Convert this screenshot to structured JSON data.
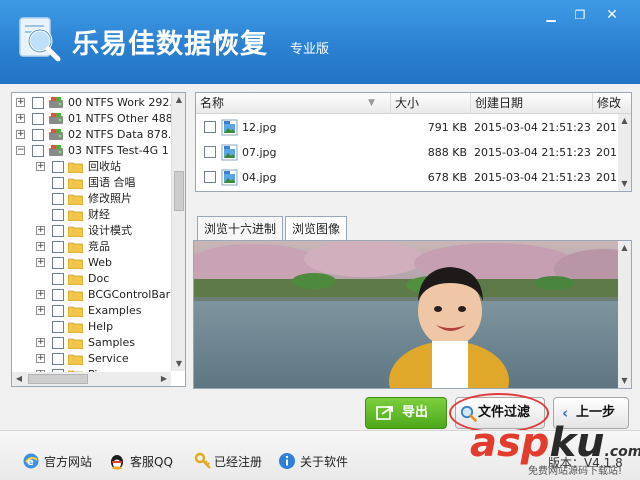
{
  "app": {
    "title": "乐易佳数据恢复",
    "edition": "专业版",
    "window_buttons": {
      "minimize": "▁",
      "maximize": "❐",
      "close": "✕"
    }
  },
  "tree": {
    "drives": [
      {
        "expander": "+",
        "label": "00  NTFS  Work  292."
      },
      {
        "expander": "+",
        "label": "01  NTFS  Other  488"
      },
      {
        "expander": "+",
        "label": "02  NTFS  Data  878."
      },
      {
        "expander": "−",
        "label": "03  NTFS  Test-4G  1"
      }
    ],
    "folders": [
      {
        "expander": "+",
        "label": "回收站"
      },
      {
        "expander": "",
        "label": "国语 合唱"
      },
      {
        "expander": "",
        "label": "修改照片"
      },
      {
        "expander": "",
        "label": "财经"
      },
      {
        "expander": "+",
        "label": "设计模式"
      },
      {
        "expander": "+",
        "label": "竞品"
      },
      {
        "expander": "+",
        "label": "Web"
      },
      {
        "expander": "",
        "label": "Doc"
      },
      {
        "expander": "+",
        "label": "BCGControlBarPr"
      },
      {
        "expander": "+",
        "label": "Examples"
      },
      {
        "expander": "",
        "label": "Help"
      },
      {
        "expander": "+",
        "label": "Samples"
      },
      {
        "expander": "+",
        "label": "Service"
      },
      {
        "expander": "+",
        "label": "Pic"
      }
    ]
  },
  "filelist": {
    "columns": [
      "名称",
      "大小",
      "创建日期",
      "修改"
    ],
    "rows": [
      {
        "name": "12.jpg",
        "size": "791 KB",
        "created": "2015-03-04  21:51:23",
        "modified": "201"
      },
      {
        "name": "07.jpg",
        "size": "888 KB",
        "created": "2015-03-04  21:51:23",
        "modified": "201"
      },
      {
        "name": "04.jpg",
        "size": "678 KB",
        "created": "2015-03-04  21:51:23",
        "modified": "201"
      }
    ]
  },
  "tabs": [
    {
      "label": "浏览十六进制"
    },
    {
      "label": "浏览图像"
    }
  ],
  "buttons": {
    "export": "导出",
    "filter": "文件过滤",
    "prev": "上一步"
  },
  "statusbar": {
    "official_site": "官方网站",
    "support_qq": "客服QQ",
    "registered": "已经注册",
    "about": "关于软件",
    "version": "版本：V4.1.8"
  },
  "watermark": {
    "brand_a": "asp",
    "brand_b": "ku",
    "suffix": ".com",
    "sub": "免费网站源码下载站!"
  },
  "colors": {
    "titlebar": "#2a7fd0",
    "export_button": "#5cb82a",
    "highlight_ring": "#e23b3b"
  }
}
